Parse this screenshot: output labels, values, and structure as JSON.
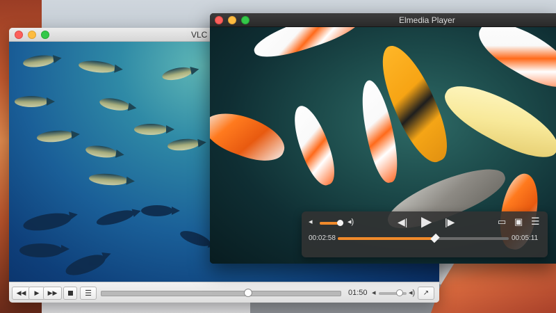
{
  "vlc": {
    "title": "VLC",
    "controls": {
      "rewind_icon": "rewind-icon",
      "play_icon": "play-icon",
      "forward_icon": "fast-forward-icon",
      "stop_icon": "stop-icon",
      "playlist_icon": "playlist-icon",
      "time": "01:50",
      "fullscreen_icon": "fullscreen-icon"
    },
    "seek_fraction": 0.61,
    "volume_fraction": 0.75
  },
  "elmedia": {
    "title": "Elmedia Player",
    "hud": {
      "elapsed": "00:02:58",
      "total": "00:05:11",
      "icons": [
        "volume-low-icon",
        "volume-high-icon",
        "previous-icon",
        "play-icon",
        "next-icon",
        "airplay-icon",
        "fullscreen-icon",
        "playlist-icon"
      ]
    },
    "seek_fraction": 0.57,
    "volume_fraction": 0.85
  },
  "colors": {
    "accent_orange": "#f08a2b",
    "close": "#fc605c",
    "minimize": "#fdbc40",
    "maximize": "#34c84a"
  }
}
